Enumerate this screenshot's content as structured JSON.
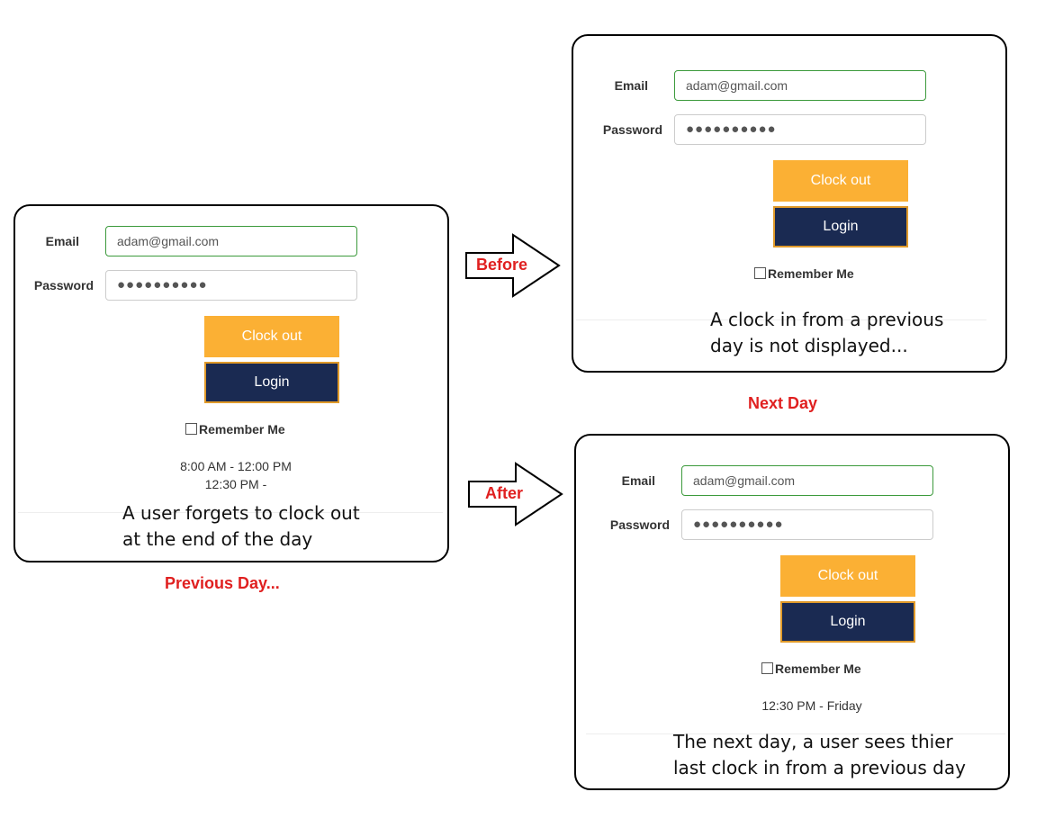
{
  "left_panel": {
    "email_label": "Email",
    "email_value": "adam@gmail.com",
    "password_label": "Password",
    "password_value": "●●●●●●●●●●",
    "clock_out_label": "Clock out",
    "login_label": "Login",
    "remember_label": "Remember Me",
    "time_line_1": "8:00 AM - 12:00 PM",
    "time_line_2": "12:30 PM -",
    "note_line_1": "A user forgets to clock out",
    "note_line_2": "at the end of the day",
    "caption": "Previous Day..."
  },
  "top_right_panel": {
    "email_label": "Email",
    "email_value": "adam@gmail.com",
    "password_label": "Password",
    "password_value": "●●●●●●●●●●",
    "clock_out_label": "Clock out",
    "login_label": "Login",
    "remember_label": "Remember Me",
    "note_line_1": "A clock in from a previous",
    "note_line_2": "day is not displayed...",
    "caption": "Next Day"
  },
  "bottom_right_panel": {
    "email_label": "Email",
    "email_value": "adam@gmail.com",
    "password_label": "Password",
    "password_value": "●●●●●●●●●●",
    "clock_out_label": "Clock out",
    "login_label": "Login",
    "remember_label": "Remember Me",
    "time_line_1": "12:30 PM - Friday",
    "note_line_1": "The next day, a user sees thier",
    "note_line_2": "last clock in from a previous day"
  },
  "arrows": {
    "before_label": "Before",
    "after_label": "After"
  },
  "colors": {
    "accent_red": "#e02020",
    "clock_out_orange": "#fbb034",
    "login_navy": "#1a2a52"
  }
}
